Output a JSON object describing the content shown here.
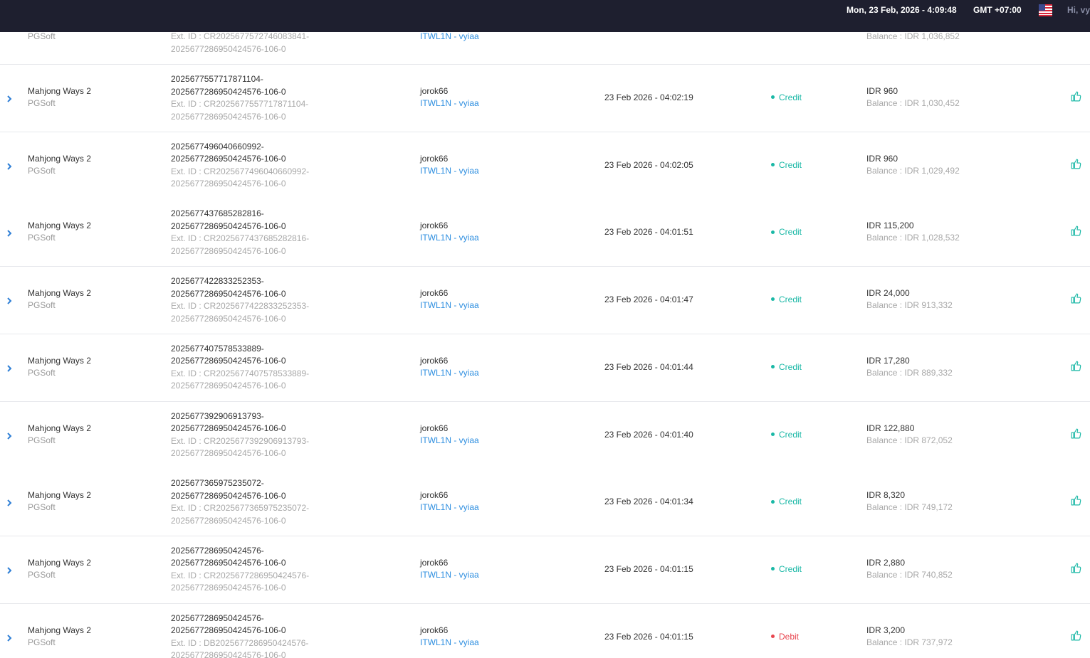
{
  "header": {
    "datetime": "Mon, 23 Feb, 2026 - 4:09:48",
    "timezone": "GMT +07:00",
    "greeting": "Hi, vy"
  },
  "colors": {
    "header_bg": "#1e1f2f",
    "credit": "#1ab8a6",
    "debit": "#e8464f",
    "link": "#2f8fe0"
  },
  "icons": {
    "expand": "chevron-right-icon",
    "action": "thumbs-up-icon",
    "language": "us-flag-icon"
  },
  "partial_row": {
    "provider": "PGSoft",
    "ext_id_1": "Ext. ID : CR2025677572746083841-",
    "ext_id_2": "2025677286950424576-106-0",
    "agent": "ITWL1N - vyiaa",
    "balance": "Balance : IDR 1,036,852"
  },
  "rows": [
    {
      "game": "Mahjong Ways 2",
      "provider": "PGSoft",
      "tx1": "2025677557717871104-",
      "tx2": "2025677286950424576-106-0",
      "ext1": "Ext. ID : CR2025677557717871104-",
      "ext2": "2025677286950424576-106-0",
      "user": "jorok66",
      "agent": "ITWL1N - vyiaa",
      "time": "23 Feb 2026 - 04:02:19",
      "status": "Credit",
      "amount": "IDR 960",
      "balance": "Balance : IDR 1,030,452"
    },
    {
      "game": "Mahjong Ways 2",
      "provider": "PGSoft",
      "tx1": "2025677496040660992-",
      "tx2": "2025677286950424576-106-0",
      "ext1": "Ext. ID : CR2025677496040660992-",
      "ext2": "2025677286950424576-106-0",
      "user": "jorok66",
      "agent": "ITWL1N - vyiaa",
      "time": "23 Feb 2026 - 04:02:05",
      "status": "Credit",
      "amount": "IDR 960",
      "balance": "Balance : IDR 1,029,492"
    },
    {
      "game": "Mahjong Ways 2",
      "provider": "PGSoft",
      "tx1": "2025677437685282816-",
      "tx2": "2025677286950424576-106-0",
      "ext1": "Ext. ID : CR2025677437685282816-",
      "ext2": "2025677286950424576-106-0",
      "user": "jorok66",
      "agent": "ITWL1N - vyiaa",
      "time": "23 Feb 2026 - 04:01:51",
      "status": "Credit",
      "amount": "IDR 115,200",
      "balance": "Balance : IDR 1,028,532"
    },
    {
      "game": "Mahjong Ways 2",
      "provider": "PGSoft",
      "tx1": "2025677422833252353-",
      "tx2": "2025677286950424576-106-0",
      "ext1": "Ext. ID : CR2025677422833252353-",
      "ext2": "2025677286950424576-106-0",
      "user": "jorok66",
      "agent": "ITWL1N - vyiaa",
      "time": "23 Feb 2026 - 04:01:47",
      "status": "Credit",
      "amount": "IDR 24,000",
      "balance": "Balance : IDR 913,332"
    },
    {
      "game": "Mahjong Ways 2",
      "provider": "PGSoft",
      "tx1": "2025677407578533889-",
      "tx2": "2025677286950424576-106-0",
      "ext1": "Ext. ID : CR2025677407578533889-",
      "ext2": "2025677286950424576-106-0",
      "user": "jorok66",
      "agent": "ITWL1N - vyiaa",
      "time": "23 Feb 2026 - 04:01:44",
      "status": "Credit",
      "amount": "IDR 17,280",
      "balance": "Balance : IDR 889,332"
    },
    {
      "game": "Mahjong Ways 2",
      "provider": "PGSoft",
      "tx1": "2025677392906913793-",
      "tx2": "2025677286950424576-106-0",
      "ext1": "Ext. ID : CR2025677392906913793-",
      "ext2": "2025677286950424576-106-0",
      "user": "jorok66",
      "agent": "ITWL1N - vyiaa",
      "time": "23 Feb 2026 - 04:01:40",
      "status": "Credit",
      "amount": "IDR 122,880",
      "balance": "Balance : IDR 872,052"
    },
    {
      "game": "Mahjong Ways 2",
      "provider": "PGSoft",
      "tx1": "2025677365975235072-",
      "tx2": "2025677286950424576-106-0",
      "ext1": "Ext. ID : CR2025677365975235072-",
      "ext2": "2025677286950424576-106-0",
      "user": "jorok66",
      "agent": "ITWL1N - vyiaa",
      "time": "23 Feb 2026 - 04:01:34",
      "status": "Credit",
      "amount": "IDR 8,320",
      "balance": "Balance : IDR 749,172"
    },
    {
      "game": "Mahjong Ways 2",
      "provider": "PGSoft",
      "tx1": "2025677286950424576-",
      "tx2": "2025677286950424576-106-0",
      "ext1": "Ext. ID : CR2025677286950424576-",
      "ext2": "2025677286950424576-106-0",
      "user": "jorok66",
      "agent": "ITWL1N - vyiaa",
      "time": "23 Feb 2026 - 04:01:15",
      "status": "Credit",
      "amount": "IDR 2,880",
      "balance": "Balance : IDR 740,852"
    },
    {
      "game": "Mahjong Ways 2",
      "provider": "PGSoft",
      "tx1": "2025677286950424576-",
      "tx2": "2025677286950424576-106-0",
      "ext1": "Ext. ID : DB2025677286950424576-",
      "ext2": "2025677286950424576-106-0",
      "user": "jorok66",
      "agent": "ITWL1N - vyiaa",
      "time": "23 Feb 2026 - 04:01:15",
      "status": "Debit",
      "amount": "IDR 3,200",
      "balance": "Balance : IDR 737,972"
    }
  ]
}
